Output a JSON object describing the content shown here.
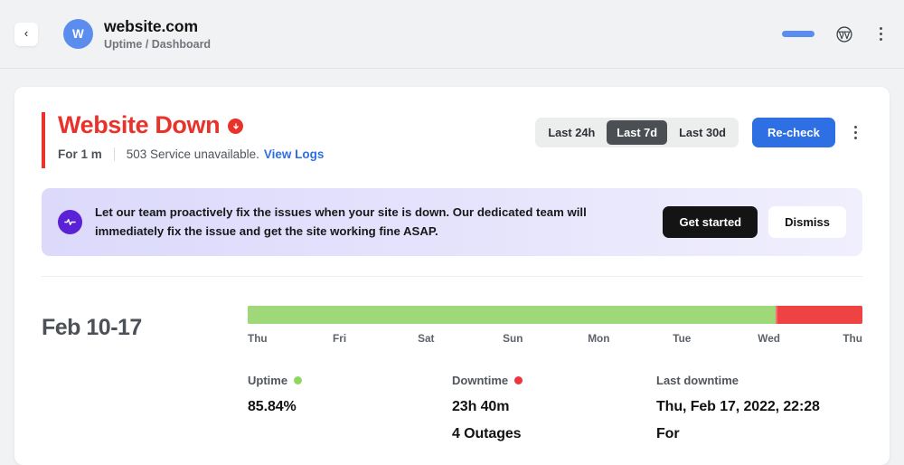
{
  "topbar": {
    "back_label": "‹",
    "avatar_initial": "W",
    "site_title": "website.com",
    "breadcrumb": "Uptime / Dashboard",
    "toggle_icon": "toggle-pill",
    "wordpress_icon": "wordpress-icon",
    "menu_icon": "kebab-menu-icon"
  },
  "status": {
    "title": "Website Down",
    "badge_icon": "arrow-down-circle-icon",
    "duration": "For 1 m",
    "error": "503 Service unavailable.",
    "link": "View Logs",
    "accent_color": "#e8322a"
  },
  "range_selector": {
    "options": [
      "Last 24h",
      "Last 7d",
      "Last 30d"
    ],
    "selected": "Last 7d"
  },
  "actions": {
    "recheck_label": "Re-check",
    "recheck_color": "#2f6fe4",
    "menu_icon": "kebab-menu-icon"
  },
  "promo": {
    "icon": "pulse-circle-icon",
    "text": "Let our team proactively fix the issues when your site is down. Our dedicated team will immediately fix the issue and get the site working fine ASAP.",
    "primary_label": "Get started",
    "secondary_label": "Dismiss"
  },
  "timeline": {
    "range_label": "Feb 10-17",
    "day_labels": [
      "Thu",
      "Fri",
      "Sat",
      "Sun",
      "Mon",
      "Tue",
      "Wed",
      "Thu"
    ],
    "up_color": "#9fd878",
    "down_color": "#ef4242",
    "segments": [
      {
        "status": "up",
        "percent": 85.84
      },
      {
        "status": "down",
        "percent": 14.16
      }
    ]
  },
  "stats": {
    "uptime": {
      "label": "Uptime",
      "dot_color": "#8fd85f",
      "value": "85.84%"
    },
    "downtime": {
      "label": "Downtime",
      "dot_color": "#f0343c",
      "value": "23h 40m",
      "value2": "4 Outages"
    },
    "last_downtime": {
      "label": "Last downtime",
      "value": "Thu, Feb 17, 2022, 22:28",
      "value2": "For"
    }
  },
  "chart_data": {
    "type": "bar",
    "title": "Feb 10-17 uptime timeline",
    "categories": [
      "Thu",
      "Fri",
      "Sat",
      "Sun",
      "Mon",
      "Tue",
      "Wed",
      "Thu"
    ],
    "series": [
      {
        "name": "Up",
        "values": [
          100,
          100,
          100,
          100,
          100,
          100,
          58,
          0
        ]
      },
      {
        "name": "Down",
        "values": [
          0,
          0,
          0,
          0,
          0,
          0,
          42,
          100
        ]
      }
    ],
    "uptime_percent": 85.84,
    "downtime_percent": 14.16,
    "downtime_duration": "23h 40m",
    "outage_count": 4,
    "legend": [
      "Uptime",
      "Downtime"
    ],
    "xlabel": "",
    "ylabel": "",
    "grid": false
  }
}
